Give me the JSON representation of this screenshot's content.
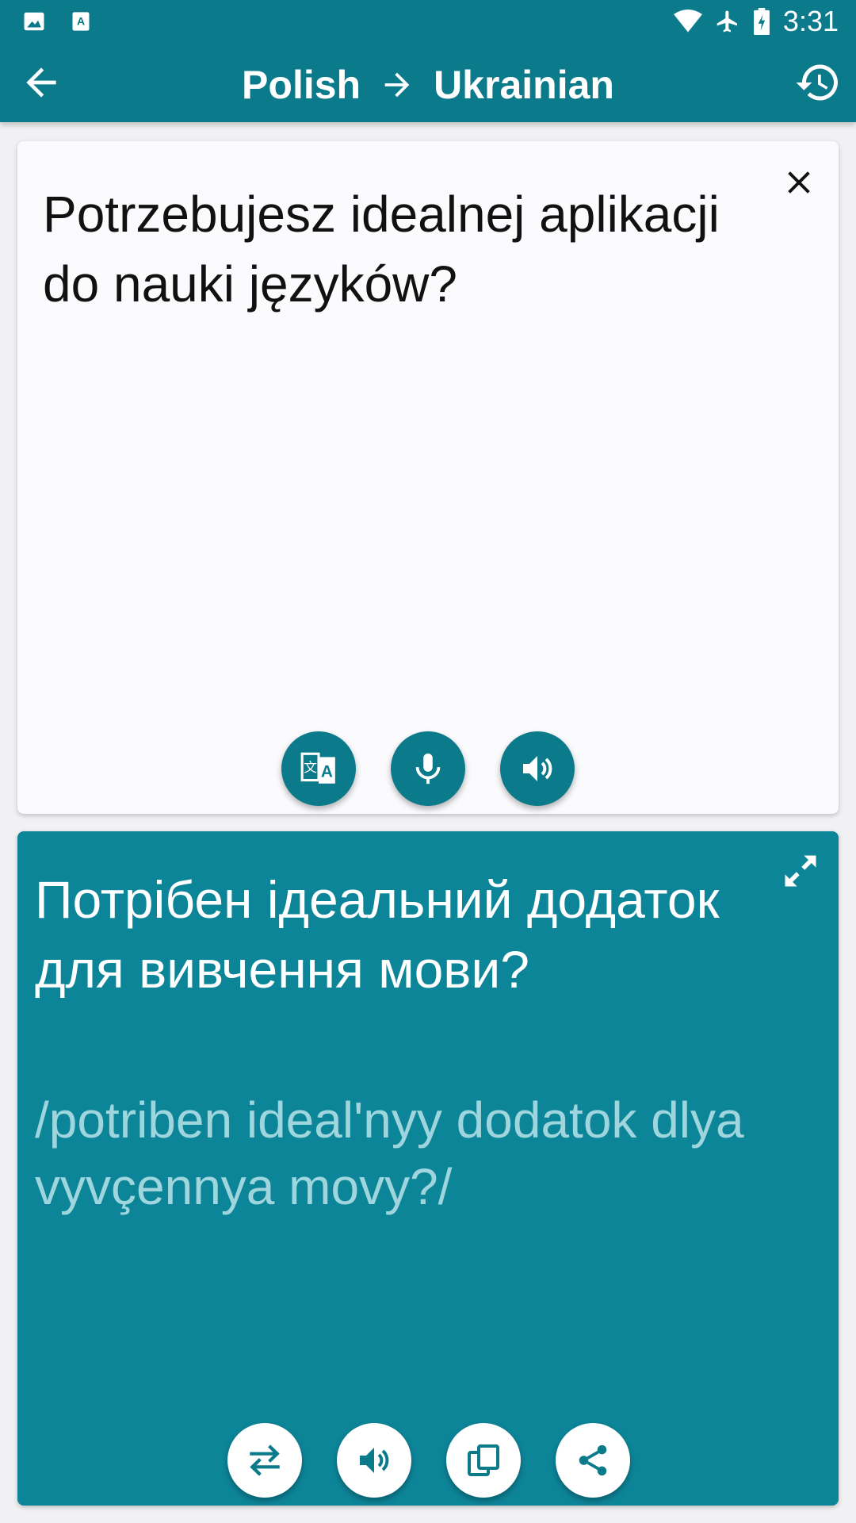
{
  "statusbar": {
    "time": "3:31",
    "icons": [
      "image-notification-icon",
      "translate-notification-icon",
      "wifi-icon",
      "airplane-icon",
      "battery-charging-icon"
    ]
  },
  "appbar": {
    "source_lang": "Polish",
    "target_lang": "Ukrainian",
    "icons": [
      "back-arrow-icon",
      "history-icon"
    ]
  },
  "source": {
    "text": "Potrzebujesz idealnej aplikacji do nauki języków?",
    "buttons": [
      "translate-button",
      "microphone-button",
      "speak-source-button"
    ]
  },
  "translation": {
    "text": "Потрібен ідеальний додаток для вивчення мови?",
    "transliteration": "/potriben ideal'nyy dodatok dlya vyvçennya movy?/",
    "buttons": [
      "swap-button",
      "speak-translation-button",
      "copy-button",
      "share-button"
    ]
  },
  "colors": {
    "primary": "#0b7a8a",
    "translation_card": "#0d8599",
    "transliteration_text": "#9fd6de"
  }
}
